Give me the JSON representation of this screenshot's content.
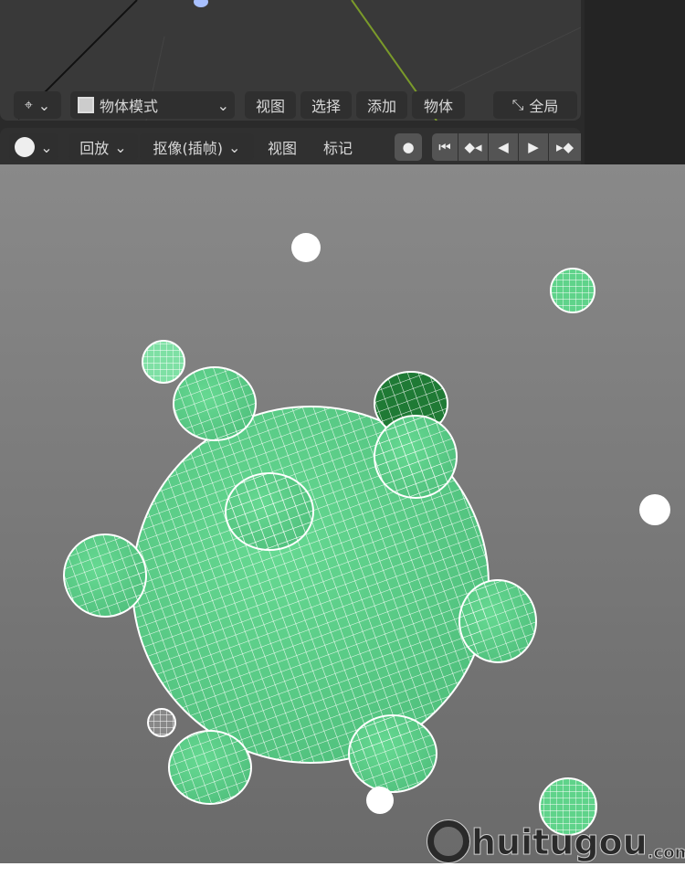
{
  "header": {
    "mode_label": "物体模式",
    "menu": [
      "视图",
      "选择",
      "添加",
      "物体"
    ],
    "orientation_label": "全局"
  },
  "timeline": {
    "playback": "回放",
    "keying": "抠像(插帧)",
    "view": "视图",
    "marker": "标记"
  },
  "watermark": {
    "text": "huitugou",
    "suffix": ".com"
  },
  "colors": {
    "mesh": "#5fd38a",
    "wire": "#ffffff",
    "viewport": "#7a7a7a"
  }
}
